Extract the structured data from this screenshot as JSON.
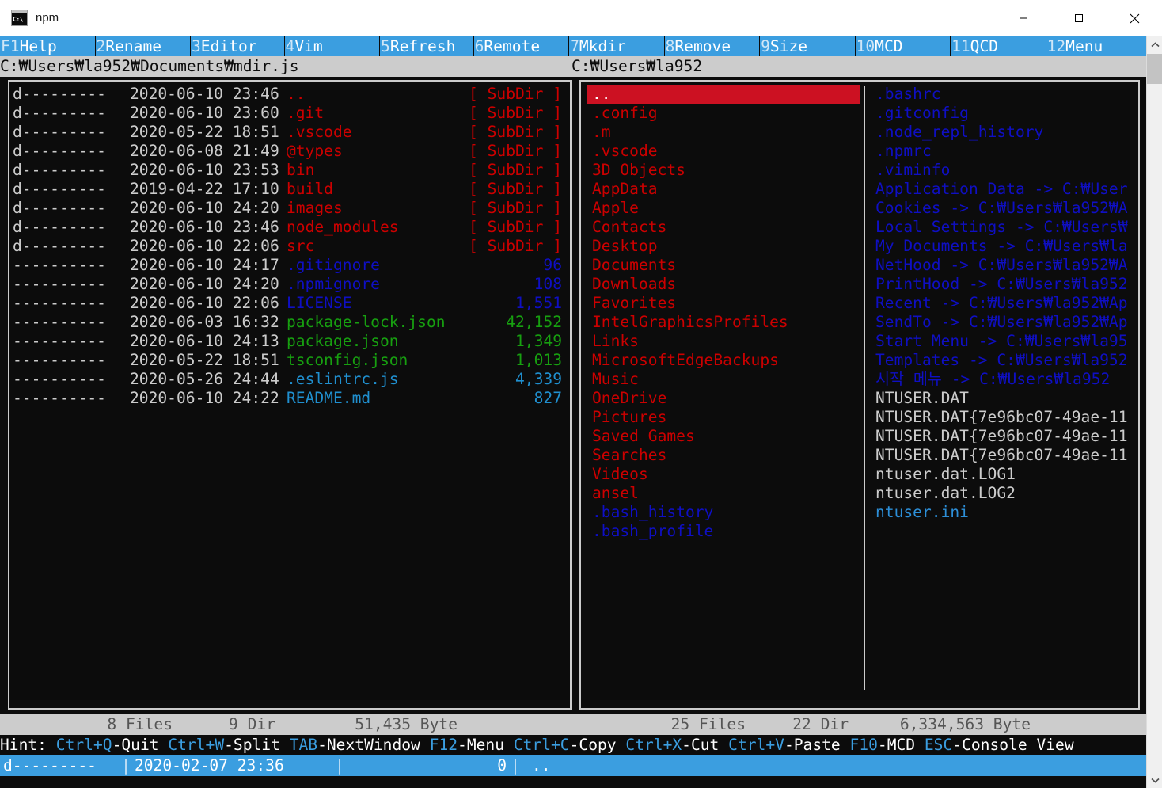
{
  "window": {
    "title": "npm",
    "icon": "console-icon",
    "icon_glyph": "C:\\",
    "minimize_label": "—",
    "maximize_label": "□",
    "close_label": "✕"
  },
  "fkeys": [
    {
      "num": "F1",
      "label": "Help"
    },
    {
      "num": "2",
      "label": "Rename"
    },
    {
      "num": "3",
      "label": "Editor"
    },
    {
      "num": "4",
      "label": "Vim"
    },
    {
      "num": "5",
      "label": "Refresh"
    },
    {
      "num": "6",
      "label": "Remote"
    },
    {
      "num": "7",
      "label": "Mkdir"
    },
    {
      "num": "8",
      "label": "Remove"
    },
    {
      "num": "9",
      "label": "Size"
    },
    {
      "num": "10",
      "label": "MCD"
    },
    {
      "num": "11",
      "label": "QCD"
    },
    {
      "num": "12",
      "label": "Menu"
    }
  ],
  "paths": {
    "left": "C:₩Users₩la952₩Documents₩mdir.js",
    "right": "C:₩Users₩la952"
  },
  "left_panel": {
    "rows": [
      {
        "attr": "d---------",
        "date": "2020-06-10 23:46",
        "name": "..",
        "size": "[ SubDir ]",
        "color": "c-dir"
      },
      {
        "attr": "d---------",
        "date": "2020-06-10 23:60",
        "name": ".git",
        "size": "[ SubDir ]",
        "color": "c-dir"
      },
      {
        "attr": "d---------",
        "date": "2020-05-22 18:51",
        "name": ".vscode",
        "size": "[ SubDir ]",
        "color": "c-dir"
      },
      {
        "attr": "d---------",
        "date": "2020-06-08 21:49",
        "name": "@types",
        "size": "[ SubDir ]",
        "color": "c-dir"
      },
      {
        "attr": "d---------",
        "date": "2020-06-10 23:53",
        "name": "bin",
        "size": "[ SubDir ]",
        "color": "c-dir"
      },
      {
        "attr": "d---------",
        "date": "2019-04-22 17:10",
        "name": "build",
        "size": "[ SubDir ]",
        "color": "c-dir"
      },
      {
        "attr": "d---------",
        "date": "2020-06-10 24:20",
        "name": "images",
        "size": "[ SubDir ]",
        "color": "c-dir"
      },
      {
        "attr": "d---------",
        "date": "2020-06-10 23:46",
        "name": "node_modules",
        "size": "[ SubDir ]",
        "color": "c-dir"
      },
      {
        "attr": "d---------",
        "date": "2020-06-10 22:06",
        "name": "src",
        "size": "[ SubDir ]",
        "color": "c-dir"
      },
      {
        "attr": "----------",
        "date": "2020-06-10 24:17",
        "name": ".gitignore",
        "size": "96",
        "color": "c-blue"
      },
      {
        "attr": "----------",
        "date": "2020-06-10 24:20",
        "name": ".npmignore",
        "size": "108",
        "color": "c-blue"
      },
      {
        "attr": "----------",
        "date": "2020-06-10 22:06",
        "name": "LICENSE",
        "size": "1,551",
        "color": "c-blue"
      },
      {
        "attr": "----------",
        "date": "2020-06-03 16:32",
        "name": "package-lock.json",
        "size": "42,152",
        "color": "c-green"
      },
      {
        "attr": "----------",
        "date": "2020-06-10 24:13",
        "name": "package.json",
        "size": "1,349",
        "color": "c-green"
      },
      {
        "attr": "----------",
        "date": "2020-05-22 18:51",
        "name": "tsconfig.json",
        "size": "1,013",
        "color": "c-green"
      },
      {
        "attr": "----------",
        "date": "2020-05-26 24:44",
        "name": ".eslintrc.js",
        "size": "4,339",
        "color": "c-cyan"
      },
      {
        "attr": "----------",
        "date": "2020-06-10 24:22",
        "name": "README.md",
        "size": "827",
        "color": "c-cyan"
      }
    ]
  },
  "right_panel": {
    "column1": [
      {
        "name": "..",
        "color": "c-dir",
        "selected": true
      },
      {
        "name": ".config",
        "color": "c-dir",
        "selected": false
      },
      {
        "name": ".m",
        "color": "c-dir",
        "selected": false
      },
      {
        "name": ".vscode",
        "color": "c-dir",
        "selected": false
      },
      {
        "name": "3D Objects",
        "color": "c-dir",
        "selected": false
      },
      {
        "name": "AppData",
        "color": "c-dir",
        "selected": false
      },
      {
        "name": "Apple",
        "color": "c-dir",
        "selected": false
      },
      {
        "name": "Contacts",
        "color": "c-dir",
        "selected": false
      },
      {
        "name": "Desktop",
        "color": "c-dir",
        "selected": false
      },
      {
        "name": "Documents",
        "color": "c-dir",
        "selected": false
      },
      {
        "name": "Downloads",
        "color": "c-dir",
        "selected": false
      },
      {
        "name": "Favorites",
        "color": "c-dir",
        "selected": false
      },
      {
        "name": "IntelGraphicsProfiles",
        "color": "c-dir",
        "selected": false
      },
      {
        "name": "Links",
        "color": "c-dir",
        "selected": false
      },
      {
        "name": "MicrosoftEdgeBackups",
        "color": "c-dir",
        "selected": false
      },
      {
        "name": "Music",
        "color": "c-dir",
        "selected": false
      },
      {
        "name": "OneDrive",
        "color": "c-dir",
        "selected": false
      },
      {
        "name": "Pictures",
        "color": "c-dir",
        "selected": false
      },
      {
        "name": "Saved Games",
        "color": "c-dir",
        "selected": false
      },
      {
        "name": "Searches",
        "color": "c-dir",
        "selected": false
      },
      {
        "name": "Videos",
        "color": "c-dir",
        "selected": false
      },
      {
        "name": "ansel",
        "color": "c-dir",
        "selected": false
      },
      {
        "name": ".bash_history",
        "color": "c-blue",
        "selected": false
      },
      {
        "name": ".bash_profile",
        "color": "c-blue",
        "selected": false
      }
    ],
    "column2": [
      {
        "name": ".bashrc",
        "color": "c-blue"
      },
      {
        "name": ".gitconfig",
        "color": "c-blue"
      },
      {
        "name": ".node_repl_history",
        "color": "c-blue"
      },
      {
        "name": ".npmrc",
        "color": "c-blue"
      },
      {
        "name": ".viminfo",
        "color": "c-blue"
      },
      {
        "name": "Application Data -> C:₩User",
        "color": "c-blue"
      },
      {
        "name": "Cookies -> C:₩Users₩la952₩A",
        "color": "c-blue"
      },
      {
        "name": "Local Settings -> C:₩Users₩",
        "color": "c-blue"
      },
      {
        "name": "My Documents -> C:₩Users₩la",
        "color": "c-blue"
      },
      {
        "name": "NetHood -> C:₩Users₩la952₩A",
        "color": "c-blue"
      },
      {
        "name": "PrintHood -> C:₩Users₩la952",
        "color": "c-blue"
      },
      {
        "name": "Recent -> C:₩Users₩la952₩Ap",
        "color": "c-blue"
      },
      {
        "name": "SendTo -> C:₩Users₩la952₩Ap",
        "color": "c-blue"
      },
      {
        "name": "Start Menu -> C:₩Users₩la95",
        "color": "c-blue"
      },
      {
        "name": "Templates -> C:₩Users₩la952",
        "color": "c-blue"
      },
      {
        "name": "시작 메뉴 -> C:₩Users₩la952",
        "color": "c-blue"
      },
      {
        "name": "NTUSER.DAT",
        "color": "c-white"
      },
      {
        "name": "NTUSER.DAT{7e96bc07-49ae-11",
        "color": "c-white"
      },
      {
        "name": "NTUSER.DAT{7e96bc07-49ae-11",
        "color": "c-white"
      },
      {
        "name": "NTUSER.DAT{7e96bc07-49ae-11",
        "color": "c-white"
      },
      {
        "name": "ntuser.dat.LOG1",
        "color": "c-white"
      },
      {
        "name": "ntuser.dat.LOG2",
        "color": "c-white"
      },
      {
        "name": "ntuser.ini",
        "color": "c-lightblue"
      }
    ]
  },
  "status": {
    "left": {
      "files": "8 Files",
      "dir": "9 Dir",
      "bytes": "51,435 Byte",
      "files_word": "",
      "dir_word": "",
      "byte_word": ""
    },
    "right": {
      "files": "25 Files",
      "dir": "22 Dir",
      "bytes": "6,334,563 Byte"
    }
  },
  "hint": {
    "prefix": "Hint: ",
    "items": [
      {
        "key": "Ctrl+Q",
        "label": "-Quit"
      },
      {
        "key": "Ctrl+W",
        "label": "-Split"
      },
      {
        "key": "TAB",
        "label": "-NextWindow"
      },
      {
        "key": "F12",
        "label": "-Menu"
      },
      {
        "key": "Ctrl+C",
        "label": "-Copy"
      },
      {
        "key": "Ctrl+X",
        "label": "-Cut"
      },
      {
        "key": "Ctrl+V",
        "label": "-Paste"
      },
      {
        "key": "F10",
        "label": "-MCD"
      },
      {
        "key": "ESC",
        "label": "-Console View"
      }
    ]
  },
  "selection_bar": {
    "attr": "d---------",
    "separator": "|",
    "date": "2020-02-07 23:36",
    "size": "0",
    "name": ".."
  },
  "scrollbar": {
    "up_arrow": "⌃",
    "down_arrow": "⌄"
  },
  "colors": {
    "accent_blue": "#3b9ee0",
    "dir_red": "#cc0000",
    "selection_red": "#cc1122",
    "file_blue": "#0f0fc4",
    "file_green": "#17a010",
    "file_cyan": "#2090d0",
    "console_bg": "#0c0c0c",
    "bar_grey": "#cccccc"
  }
}
